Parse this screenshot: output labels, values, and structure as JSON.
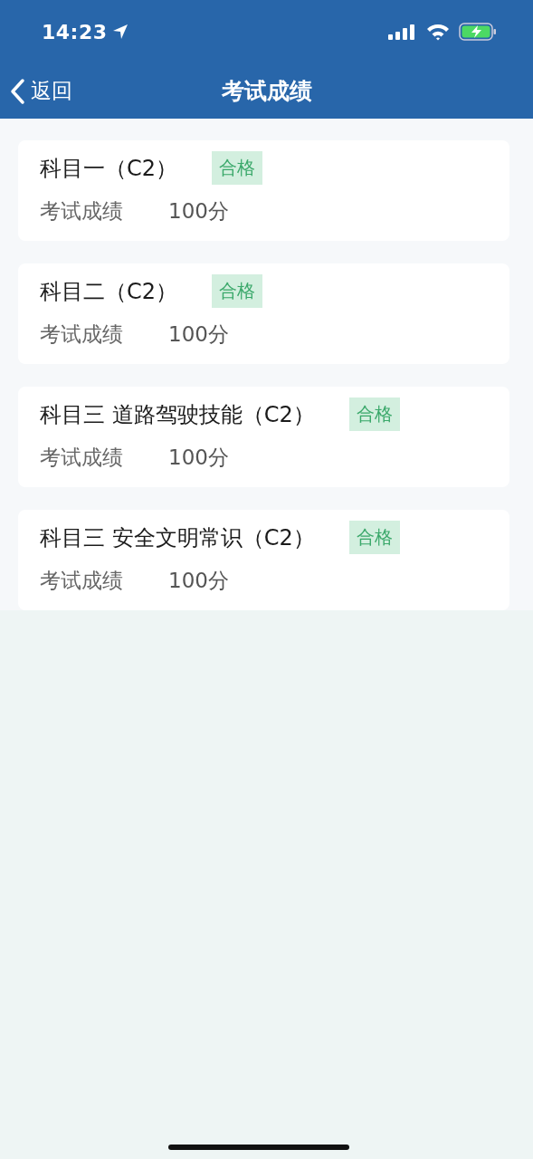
{
  "status_bar": {
    "time": "14:23"
  },
  "nav": {
    "back_label": "返回",
    "title": "考试成绩"
  },
  "results": [
    {
      "subject": "科目一（C2）",
      "status": "合格",
      "score_label": "考试成绩",
      "score": "100分"
    },
    {
      "subject": "科目二（C2）",
      "status": "合格",
      "score_label": "考试成绩",
      "score": "100分"
    },
    {
      "subject": "科目三 道路驾驶技能（C2）",
      "status": "合格",
      "score_label": "考试成绩",
      "score": "100分"
    },
    {
      "subject": "科目三 安全文明常识（C2）",
      "status": "合格",
      "score_label": "考试成绩",
      "score": "100分"
    }
  ]
}
